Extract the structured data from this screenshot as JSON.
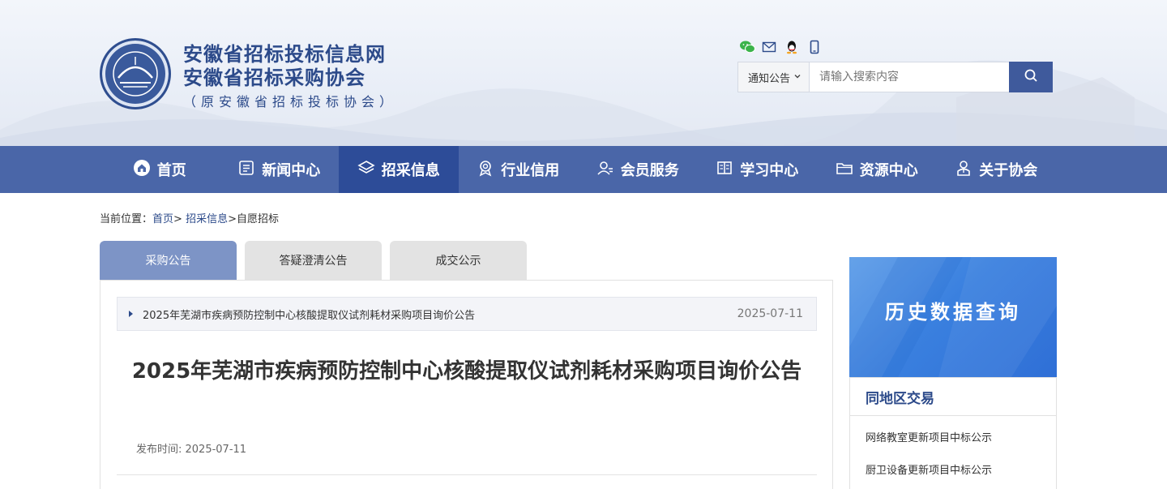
{
  "header": {
    "title1": "安徽省招标投标信息网",
    "title2": "安徽省招标采购协会",
    "subtitle": "（原安徽省招标投标协会）"
  },
  "social_icons": [
    "wechat-icon",
    "mail-icon",
    "qq-icon",
    "mobile-icon"
  ],
  "search": {
    "category": "通知公告",
    "placeholder": "请输入搜索内容"
  },
  "nav": {
    "items": [
      {
        "label": "首页",
        "icon": "home-icon"
      },
      {
        "label": "新闻中心",
        "icon": "news-icon"
      },
      {
        "label": "招采信息",
        "icon": "layers-icon",
        "active": true
      },
      {
        "label": "行业信用",
        "icon": "badge-icon"
      },
      {
        "label": "会员服务",
        "icon": "members-icon"
      },
      {
        "label": "学习中心",
        "icon": "book-icon"
      },
      {
        "label": "资源中心",
        "icon": "folder-icon"
      },
      {
        "label": "关于协会",
        "icon": "user-icon"
      }
    ]
  },
  "breadcrumb": {
    "prefix": "当前位置：",
    "home": "首页",
    "sep1": ">",
    "section": "招采信息",
    "sep2": ">",
    "current": "自愿招标"
  },
  "tabs": [
    {
      "label": "采购公告",
      "active": true
    },
    {
      "label": "答疑澄清公告"
    },
    {
      "label": "成交公示"
    }
  ],
  "notice": {
    "title": "2025年芜湖市疾病预防控制中心核酸提取仪试剂耗材采购项目询价公告",
    "date": "2025-07-11"
  },
  "article": {
    "title": "2025年芜湖市疾病预防控制中心核酸提取仪试剂耗材采购项目询价公告",
    "publish_label": "发布时间: ",
    "publish_date": "2025-07-11"
  },
  "sidebar": {
    "history_label": "历史数据查询",
    "region_title": "同地区交易",
    "region_items": [
      "网络教室更新项目中标公示",
      "厨卫设备更新项目中标公示"
    ]
  },
  "colors": {
    "nav_bg": "#4a66a8",
    "nav_active": "#2d4c98",
    "brand": "#2c4a8a",
    "tab_active": "#7d94c6",
    "history_blue": "#3a80df"
  }
}
